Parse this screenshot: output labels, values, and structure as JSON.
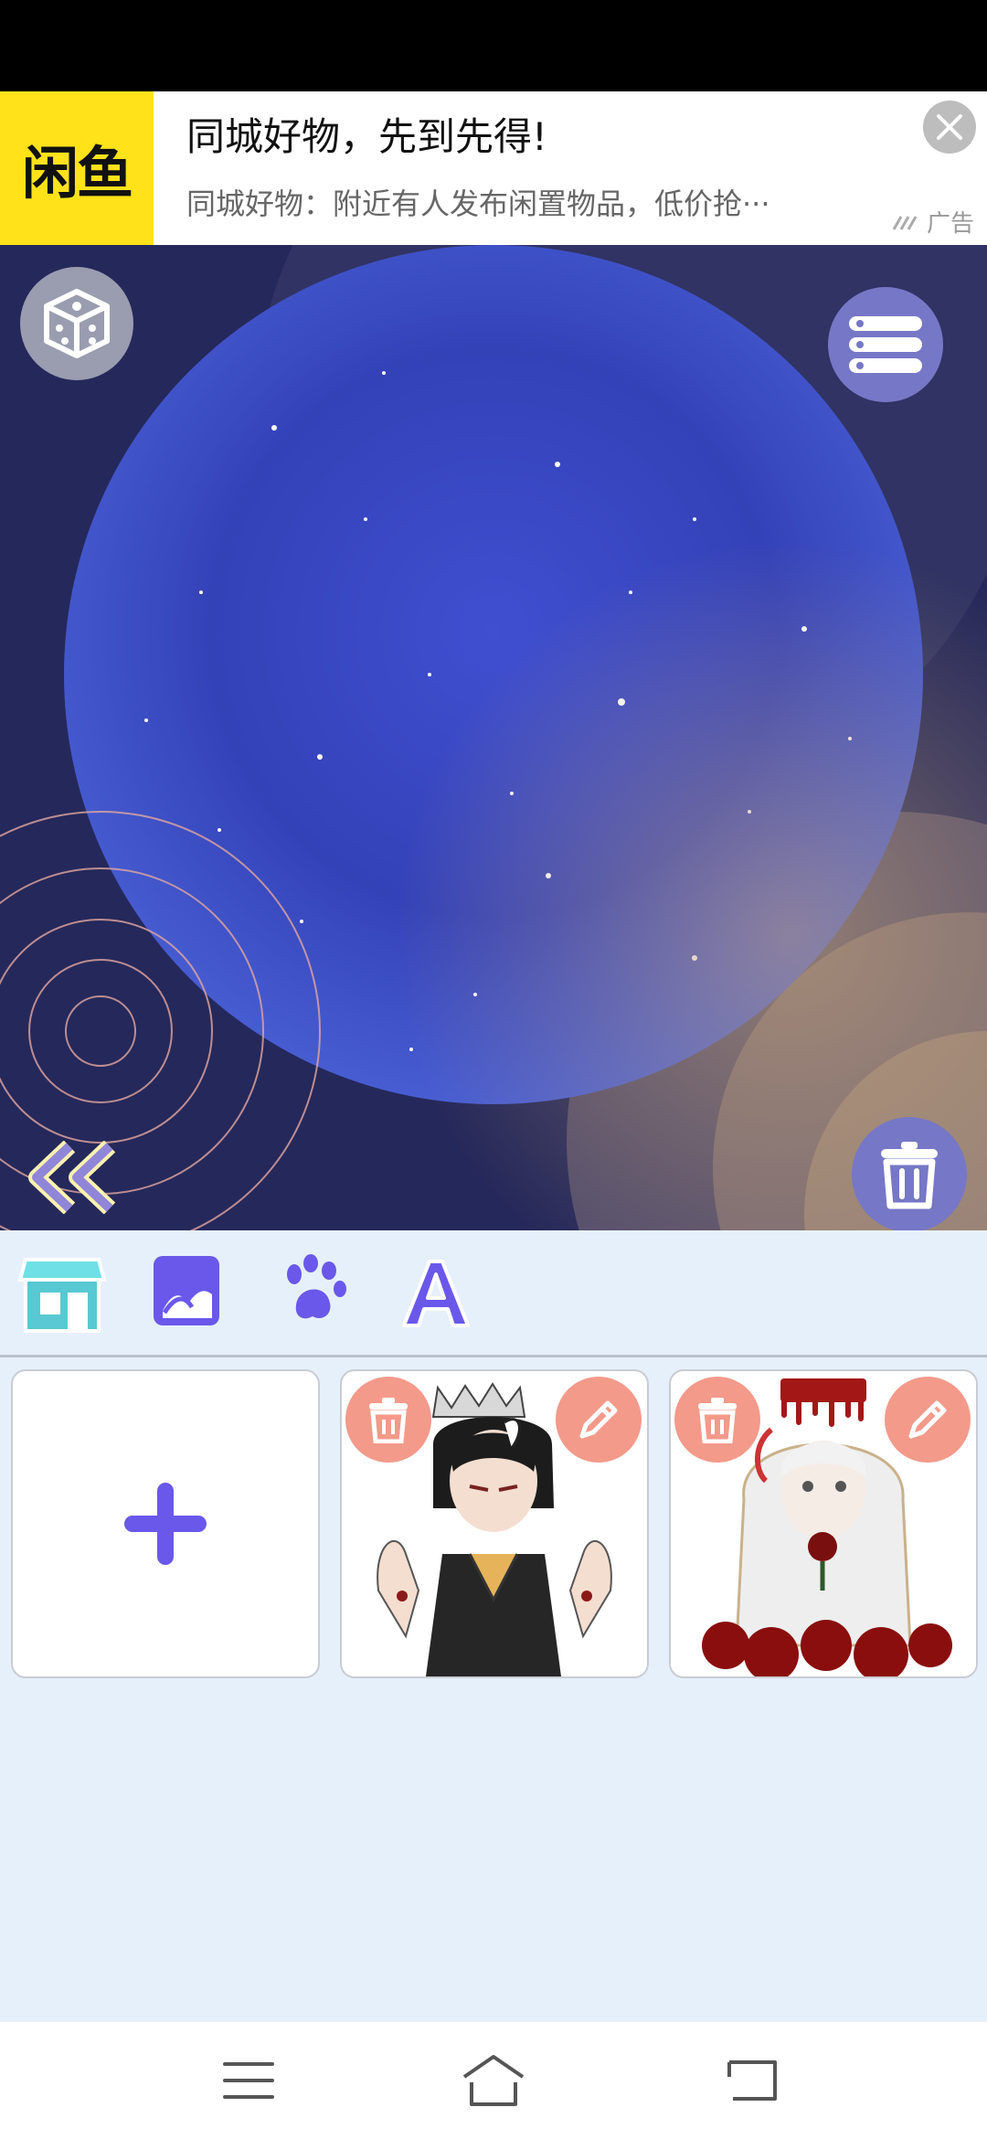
{
  "ad": {
    "logo_text": "闲鱼",
    "title": "同城好物，先到先得!",
    "subtitle": "同城好物：附近有人发布闲置物品，低价抢···",
    "tag": "广告",
    "icons": {
      "close": "close-icon",
      "ad_mark": "ad-mark-icon"
    }
  },
  "stage": {
    "icons": {
      "random": "dice-icon",
      "menu": "list-icon",
      "back": "double-chevron-left-icon",
      "delete": "trash-icon"
    },
    "colors": {
      "background": "#25285a",
      "galaxy": "#3a49c4",
      "accent": "#6e6ed0"
    }
  },
  "toolbar": {
    "tools": [
      {
        "name": "shop",
        "icon": "shop-icon"
      },
      {
        "name": "background",
        "icon": "image-icon"
      },
      {
        "name": "pets",
        "icon": "paw-icon"
      },
      {
        "name": "text",
        "icon": "text-icon",
        "glyph": "A"
      }
    ]
  },
  "cards": {
    "add_label": "+",
    "items": [
      {
        "name": "character-dark-boy",
        "icons": [
          "trash-icon",
          "pencil-icon"
        ]
      },
      {
        "name": "character-white-hair-girl",
        "icons": [
          "trash-icon",
          "pencil-icon"
        ]
      }
    ]
  },
  "nav": {
    "icons": [
      "menu-lines-icon",
      "home-icon",
      "back-icon"
    ]
  }
}
